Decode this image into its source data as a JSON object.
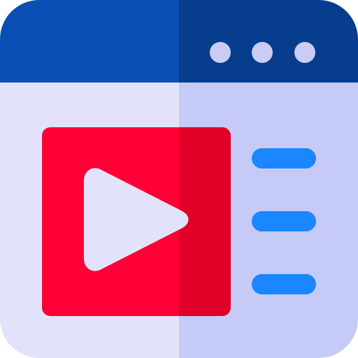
{
  "icon": {
    "name": "video-player-browser-icon",
    "parts": [
      "browser-window",
      "title-bar",
      "window-control-dots",
      "video-thumbnail",
      "play-icon",
      "content-lines"
    ]
  },
  "colors": {
    "header_left": "#0A4FB3",
    "header_right": "#073D8C",
    "body_left": "#E2E3FA",
    "body_right": "#C6CAF6",
    "dots": "#C9CCF4",
    "video_left": "#FF0036",
    "video_right": "#E00028",
    "play": "#E2E3FA",
    "lines": "#1A86FF"
  },
  "window_control_dots": 3,
  "content_lines": 3
}
